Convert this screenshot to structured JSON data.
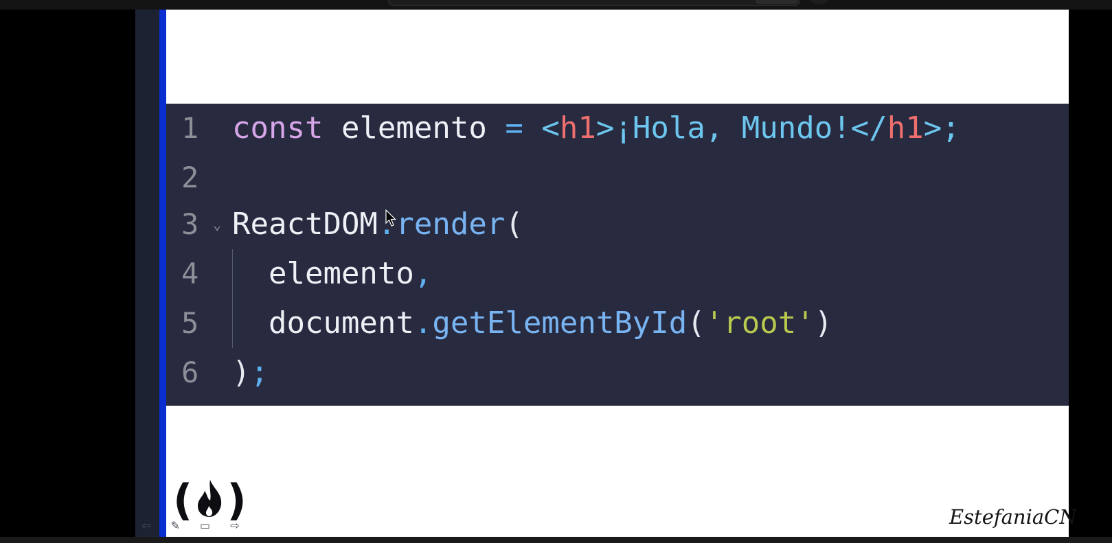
{
  "code_editor": {
    "lines": [
      {
        "number": "1",
        "tokens": [
          {
            "text": "const",
            "kind": "kw"
          },
          {
            "text": " ",
            "kind": "id"
          },
          {
            "text": "elemento",
            "kind": "id"
          },
          {
            "text": " ",
            "kind": "id"
          },
          {
            "text": "=",
            "kind": "op"
          },
          {
            "text": " ",
            "kind": "id"
          },
          {
            "text": "<",
            "kind": "txt"
          },
          {
            "text": "h1",
            "kind": "tag"
          },
          {
            "text": ">",
            "kind": "txt"
          },
          {
            "text": "¡Hola, Mundo!",
            "kind": "txt"
          },
          {
            "text": "</",
            "kind": "txt"
          },
          {
            "text": "h1",
            "kind": "tag"
          },
          {
            "text": ">;",
            "kind": "txt"
          }
        ]
      },
      {
        "number": "2",
        "tokens": []
      },
      {
        "number": "3",
        "fold": "⌄",
        "tokens": [
          {
            "text": "ReactDOM",
            "kind": "id"
          },
          {
            "text": ".",
            "kind": "op"
          },
          {
            "text": "render",
            "kind": "fn"
          },
          {
            "text": "(",
            "kind": "paren"
          }
        ]
      },
      {
        "number": "4",
        "tokens": [
          {
            "text": "  elemento",
            "kind": "id"
          },
          {
            "text": ",",
            "kind": "op"
          }
        ]
      },
      {
        "number": "5",
        "tokens": [
          {
            "text": "  document",
            "kind": "id"
          },
          {
            "text": ".",
            "kind": "op"
          },
          {
            "text": "getElementById",
            "kind": "fn"
          },
          {
            "text": "(",
            "kind": "paren"
          },
          {
            "text": "'root'",
            "kind": "str"
          },
          {
            "text": ")",
            "kind": "paren"
          }
        ]
      },
      {
        "number": "6",
        "tokens": [
          {
            "text": ")",
            "kind": "paren"
          },
          {
            "text": ";",
            "kind": "op"
          }
        ]
      }
    ]
  },
  "logo": {
    "icon": "freecodecamp-flame-icon",
    "open": "(",
    "close": ")"
  },
  "signature": "EstefaniaCN",
  "nav_controls": {
    "icons": [
      "back-arrow-icon",
      "pen-icon",
      "slides-icon",
      "forward-arrow-icon"
    ],
    "glyphs": "⇦ ✎ ▭ ⇨"
  },
  "colors": {
    "accent_bar": "#0a2fd0",
    "code_background": "#282b40",
    "keyword": "#d6a6e8",
    "tag": "#ef6f6f",
    "jsx_text": "#6cc6ee",
    "function": "#79b4f2",
    "string": "#b8c94e"
  }
}
